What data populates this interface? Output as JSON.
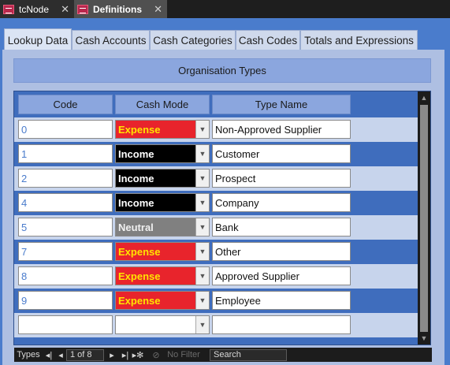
{
  "doc_tabs": [
    {
      "label": "tcNode",
      "close": "✕"
    },
    {
      "label": "Definitions",
      "close": "✕"
    }
  ],
  "page_tabs": [
    "Lookup Data",
    "Cash Accounts",
    "Cash Categories",
    "Cash Codes",
    "Totals and Expressions"
  ],
  "section_title": "Organisation Types",
  "columns": {
    "code": "Code",
    "cash_mode": "Cash Mode",
    "type_name": "Type Name"
  },
  "rows": [
    {
      "code": "0",
      "cash_mode": "Expense",
      "type_name": "Non-Approved Supplier"
    },
    {
      "code": "1",
      "cash_mode": "Income",
      "type_name": "Customer"
    },
    {
      "code": "2",
      "cash_mode": "Income",
      "type_name": "Prospect"
    },
    {
      "code": "4",
      "cash_mode": "Income",
      "type_name": "Company"
    },
    {
      "code": "5",
      "cash_mode": "Neutral",
      "type_name": "Bank"
    },
    {
      "code": "7",
      "cash_mode": "Expense",
      "type_name": "Other"
    },
    {
      "code": "8",
      "cash_mode": "Expense",
      "type_name": "Approved Supplier"
    },
    {
      "code": "9",
      "cash_mode": "Expense",
      "type_name": "Employee"
    }
  ],
  "navbar": {
    "label": "Types",
    "first": "◂|",
    "prev": "◂",
    "record": "1 of 8",
    "next": "▸",
    "last": "▸|",
    "new": "▸✻",
    "filter": "No Filter",
    "search": "Search"
  },
  "colors": {
    "expense_bg": "#e8242c",
    "expense_text": "#ffe400",
    "income_bg": "#000000",
    "neutral_bg": "#808080",
    "accent": "#4a7ccc"
  }
}
